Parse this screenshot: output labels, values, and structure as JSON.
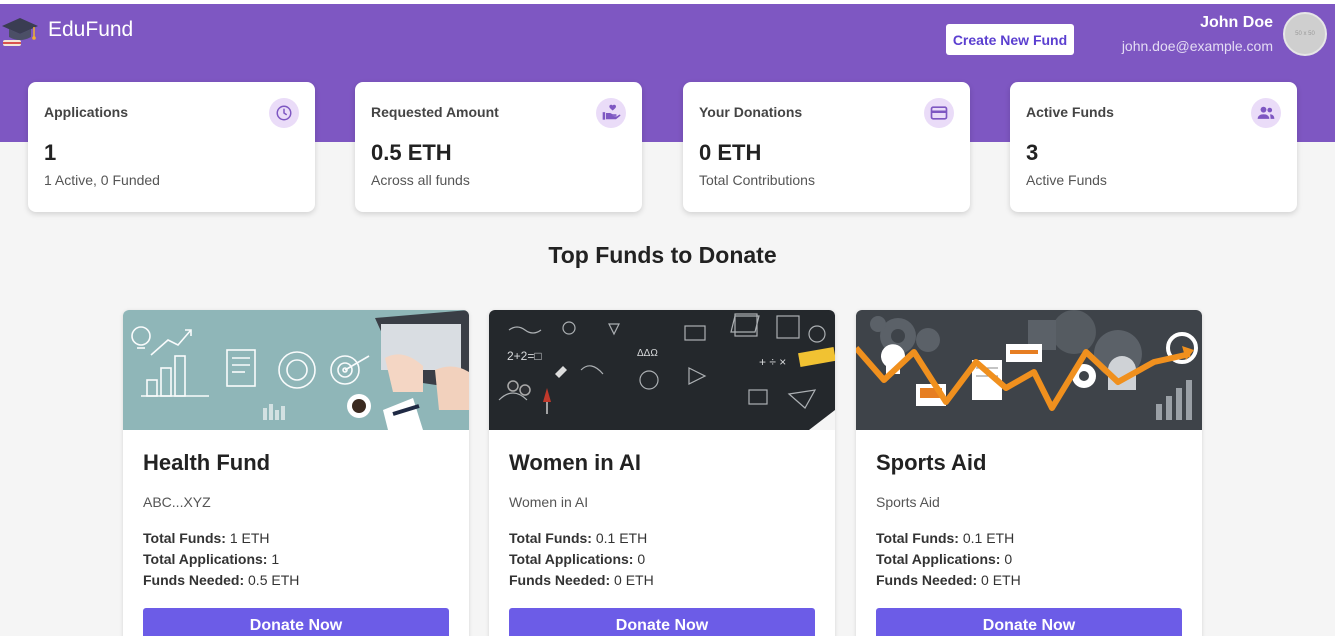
{
  "brand": {
    "name": "EduFund",
    "logo_icon": "graduation-cap-icon"
  },
  "header": {
    "create_button": "Create New Fund",
    "user": {
      "name": "John Doe",
      "email": "john.doe@example.com",
      "avatar_text": "50 x 50"
    }
  },
  "stats": [
    {
      "title": "Applications",
      "value": "1",
      "sub": "1 Active, 0 Funded",
      "icon": "clock-icon"
    },
    {
      "title": "Requested Amount",
      "value": "0.5 ETH",
      "sub": "Across all funds",
      "icon": "hand-heart-icon"
    },
    {
      "title": "Your Donations",
      "value": "0 ETH",
      "sub": "Total Contributions",
      "icon": "credit-card-icon"
    },
    {
      "title": "Active Funds",
      "value": "3",
      "sub": "Active Funds",
      "icon": "people-icon"
    }
  ],
  "section_title": "Top Funds to Donate",
  "labels": {
    "total_funds": "Total Funds:",
    "total_applications": "Total Applications:",
    "funds_needed": "Funds Needed:"
  },
  "funds": [
    {
      "name": "Health Fund",
      "description": "ABC...XYZ",
      "total_funds": "1 ETH",
      "total_applications": "1",
      "funds_needed": "0.5 ETH",
      "button": "Donate Now"
    },
    {
      "name": "Women in AI",
      "description": "Women in AI",
      "total_funds": "0.1 ETH",
      "total_applications": "0",
      "funds_needed": "0 ETH",
      "button": "Donate Now"
    },
    {
      "name": "Sports Aid",
      "description": "Sports Aid",
      "total_funds": "0.1 ETH",
      "total_applications": "0",
      "funds_needed": "0 ETH",
      "button": "Donate Now"
    }
  ],
  "colors": {
    "header": "#7e57c2",
    "accent": "#6c5ce7",
    "icon_bg": "#eadcf8",
    "icon_fg": "#7e57c2"
  }
}
